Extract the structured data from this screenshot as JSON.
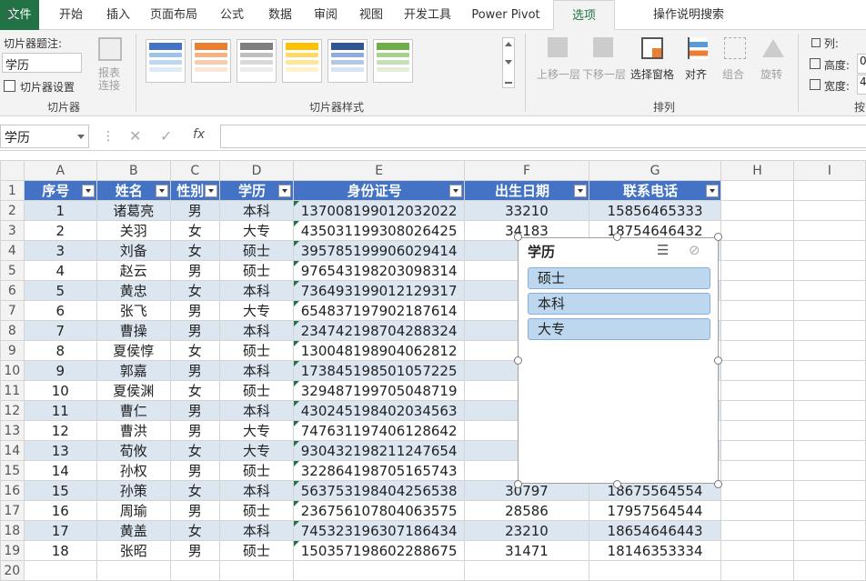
{
  "tabs": [
    "文件",
    "开始",
    "插入",
    "页面布局",
    "公式",
    "数据",
    "审阅",
    "视图",
    "开发工具",
    "Power Pivot",
    "选项",
    "操作说明搜索"
  ],
  "ribbon": {
    "caption_label": "切片器题注:",
    "caption_value": "学历",
    "settings": "切片器设置",
    "report_conn": "报表\n连接",
    "group1": "切片器",
    "group2": "切片器样式",
    "bring_forward": "上移一层",
    "send_backward": "下移一层",
    "selection_pane": "选择窗格",
    "align": "对齐",
    "group": "组合",
    "rotate": "旋转",
    "group3": "排列",
    "columns": "列:",
    "height": "高度:",
    "width": "宽度:",
    "height_val": "0",
    "width_val": "4",
    "group4": "按"
  },
  "namebox": "学历",
  "columns": [
    "A",
    "B",
    "C",
    "D",
    "E",
    "F",
    "G",
    "H",
    "I"
  ],
  "headers": [
    "序号",
    "姓名",
    "性别",
    "学历",
    "身份证号",
    "出生日期",
    "联系电话"
  ],
  "rows": [
    [
      "1",
      "诸葛亮",
      "男",
      "本科",
      "137008199012032022",
      "33210",
      "15856465333"
    ],
    [
      "2",
      "关羽",
      "女",
      "大专",
      "435031199308026425",
      "34183",
      "18754646432"
    ],
    [
      "3",
      "刘备",
      "女",
      "硕士",
      "395785199906029414",
      "",
      ""
    ],
    [
      "4",
      "赵云",
      "男",
      "硕士",
      "976543198203098314",
      "",
      ""
    ],
    [
      "5",
      "黄忠",
      "女",
      "本科",
      "736493199012129317",
      "",
      ""
    ],
    [
      "6",
      "张飞",
      "男",
      "大专",
      "654837197902187614",
      "",
      ""
    ],
    [
      "7",
      "曹操",
      "男",
      "本科",
      "234742198704288324",
      "",
      ""
    ],
    [
      "8",
      "夏侯惇",
      "女",
      "硕士",
      "130048198904062812",
      "",
      ""
    ],
    [
      "9",
      "郭嘉",
      "男",
      "本科",
      "173845198501057225",
      "",
      ""
    ],
    [
      "10",
      "夏侯渊",
      "女",
      "硕士",
      "329487199705048719",
      "",
      ""
    ],
    [
      "11",
      "曹仁",
      "男",
      "本科",
      "430245198402034563",
      "",
      ""
    ],
    [
      "12",
      "曹洪",
      "男",
      "大专",
      "747631197406128642",
      "",
      ""
    ],
    [
      "13",
      "荀攸",
      "女",
      "大专",
      "930432198211247654",
      "",
      ""
    ],
    [
      "14",
      "孙权",
      "男",
      "硕士",
      "322864198705165743",
      "",
      ""
    ],
    [
      "15",
      "孙策",
      "女",
      "本科",
      "563753198404256538",
      "30797",
      "18675564554"
    ],
    [
      "16",
      "周瑜",
      "男",
      "硕士",
      "236756107804063575",
      "28586",
      "17957564544"
    ],
    [
      "17",
      "黄盖",
      "女",
      "本科",
      "745323196307186434",
      "23210",
      "18654646443"
    ],
    [
      "18",
      "张昭",
      "男",
      "硕士",
      "150357198602288675",
      "31471",
      "18146353334"
    ]
  ],
  "slicer": {
    "title": "学历",
    "items": [
      "硕士",
      "本科",
      "大专"
    ]
  },
  "colors": {
    "accent": "#217346",
    "header_blue": "#4472c4",
    "band": "#dce6f1",
    "slicer_item": "#bdd7ee"
  }
}
